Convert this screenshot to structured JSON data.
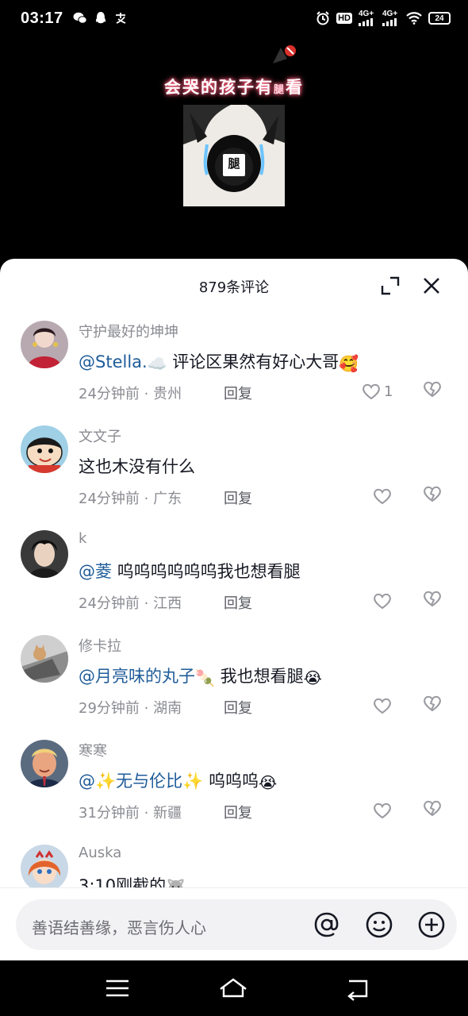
{
  "status_bar": {
    "time": "03:17",
    "network_1": "4G+",
    "network_2": "4G+",
    "hd_label": "HD",
    "battery": "24",
    "left_icons": [
      "wechat-icon",
      "qq-icon",
      "alipay-icon"
    ]
  },
  "video": {
    "title_main": "会哭的孩子有",
    "title_small": "腿",
    "title_end": "看",
    "meme_caption": "腿"
  },
  "sheet": {
    "title": "879条评论"
  },
  "comments": [
    {
      "user": "守护最好的坤坤",
      "mention": "@Stella.",
      "mention_emoji": "☁️",
      "text": " 评论区果然有好心大哥",
      "text_emoji": "🥰",
      "time": "24分钟前",
      "location": "贵州",
      "reply": "回复",
      "likes": "1"
    },
    {
      "user": "文文子",
      "mention": "",
      "mention_emoji": "",
      "text": "这也木没有什么",
      "text_emoji": "",
      "time": "24分钟前",
      "location": "广东",
      "reply": "回复",
      "likes": ""
    },
    {
      "user": "k",
      "mention": "@菱",
      "mention_emoji": "",
      "text": " 呜呜呜呜呜呜我也想看腿",
      "text_emoji": "",
      "time": "24分钟前",
      "location": "江西",
      "reply": "回复",
      "likes": ""
    },
    {
      "user": "修卡拉",
      "mention": "@月亮味的丸子",
      "mention_emoji": "🍡",
      "text": " 我也想看腿",
      "text_emoji": "😭",
      "time": "29分钟前",
      "location": "湖南",
      "reply": "回复",
      "likes": ""
    },
    {
      "user": "寒寒",
      "mention": "@✨无与伦比✨",
      "mention_emoji": "",
      "text": " 呜呜呜",
      "text_emoji": "😭",
      "time": "31分钟前",
      "location": "新疆",
      "reply": "回复",
      "likes": ""
    },
    {
      "user": "Auska",
      "mention": "",
      "mention_emoji": "",
      "text": "3:10刚截的",
      "text_emoji": "🐺",
      "time": "",
      "location": "",
      "reply": "",
      "likes": ""
    }
  ],
  "input_bar": {
    "placeholder": "善语结善缘，恶言伤人心",
    "at_icon": "at-icon",
    "emoji_icon": "emoji-icon",
    "add_icon": "plus-circle-icon"
  },
  "nav_bar": {
    "buttons": [
      "menu-icon",
      "home-icon",
      "back-icon"
    ]
  },
  "colors": {
    "mention": "#1f5c99",
    "meta": "#8a8b91",
    "text": "#161823",
    "glow": "#ff5a7a"
  }
}
